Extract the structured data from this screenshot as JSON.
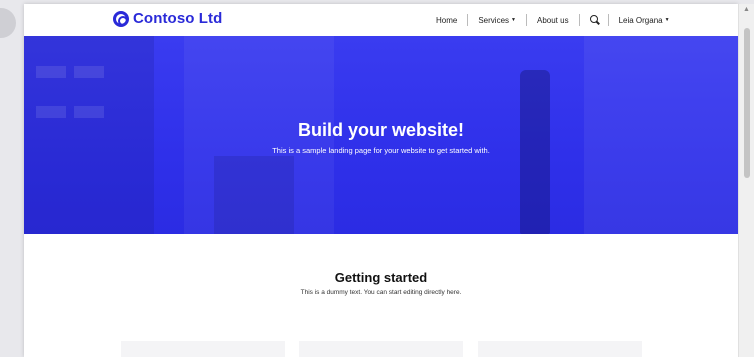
{
  "brand": {
    "name": "Contoso Ltd"
  },
  "nav": {
    "home": "Home",
    "services": "Services",
    "about": "About us",
    "user": "Leia Organa",
    "caret": "▼",
    "search_icon": "search-icon"
  },
  "hero": {
    "title": "Build your website!",
    "subtitle": "This is a sample landing page for your website to get started with."
  },
  "getting_started": {
    "title": "Getting started",
    "subtitle": "This is a dummy text. You can start editing directly here."
  },
  "scrollbar": {
    "up_arrow": "▲"
  },
  "colors": {
    "brand": "#2a2ad8",
    "hero": "#3a3cf0"
  }
}
